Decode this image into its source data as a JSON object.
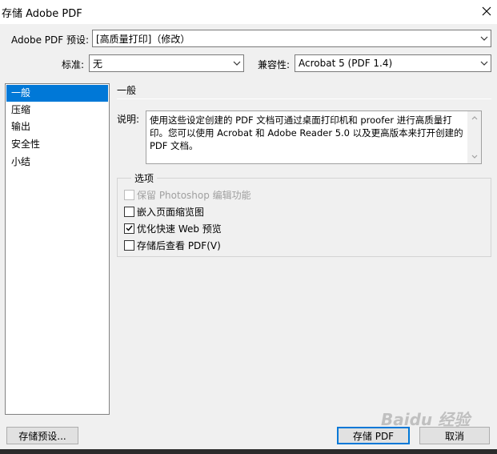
{
  "window": {
    "title": "存储 Adobe PDF"
  },
  "preset": {
    "label": "Adobe PDF 预设:",
    "value": "[高质量打印]（修改）"
  },
  "standard": {
    "label": "标准:",
    "value": "无"
  },
  "compat": {
    "label": "兼容性:",
    "value": "Acrobat 5 (PDF 1.4)"
  },
  "nav": {
    "items": [
      {
        "label": "一般"
      },
      {
        "label": "压缩"
      },
      {
        "label": "输出"
      },
      {
        "label": "安全性"
      },
      {
        "label": "小结"
      }
    ]
  },
  "section": {
    "title": "一般"
  },
  "description": {
    "label": "说明:",
    "text": "使用这些设定创建的 PDF 文档可通过桌面打印机和 proofer 进行高质量打印。您可以使用 Acrobat 和 Adobe Reader 5.0 以及更高版本来打开创建的 PDF 文档。"
  },
  "options": {
    "legend": "选项",
    "items": [
      {
        "label": "保留 Photoshop 编辑功能",
        "checked": false,
        "enabled": false
      },
      {
        "label": "嵌入页面缩览图",
        "checked": false,
        "enabled": true
      },
      {
        "label": "优化快速 Web 预览",
        "checked": true,
        "enabled": true
      },
      {
        "label": "存储后查看 PDF(V)",
        "checked": false,
        "enabled": true
      }
    ]
  },
  "buttons": {
    "save_preset": "存储预设...",
    "save_pdf": "存储 PDF",
    "cancel": "取消"
  },
  "watermark": {
    "text": "Baidu 经验"
  },
  "colors": {
    "selection": "#0078d7",
    "background": "#f0f0f0"
  }
}
